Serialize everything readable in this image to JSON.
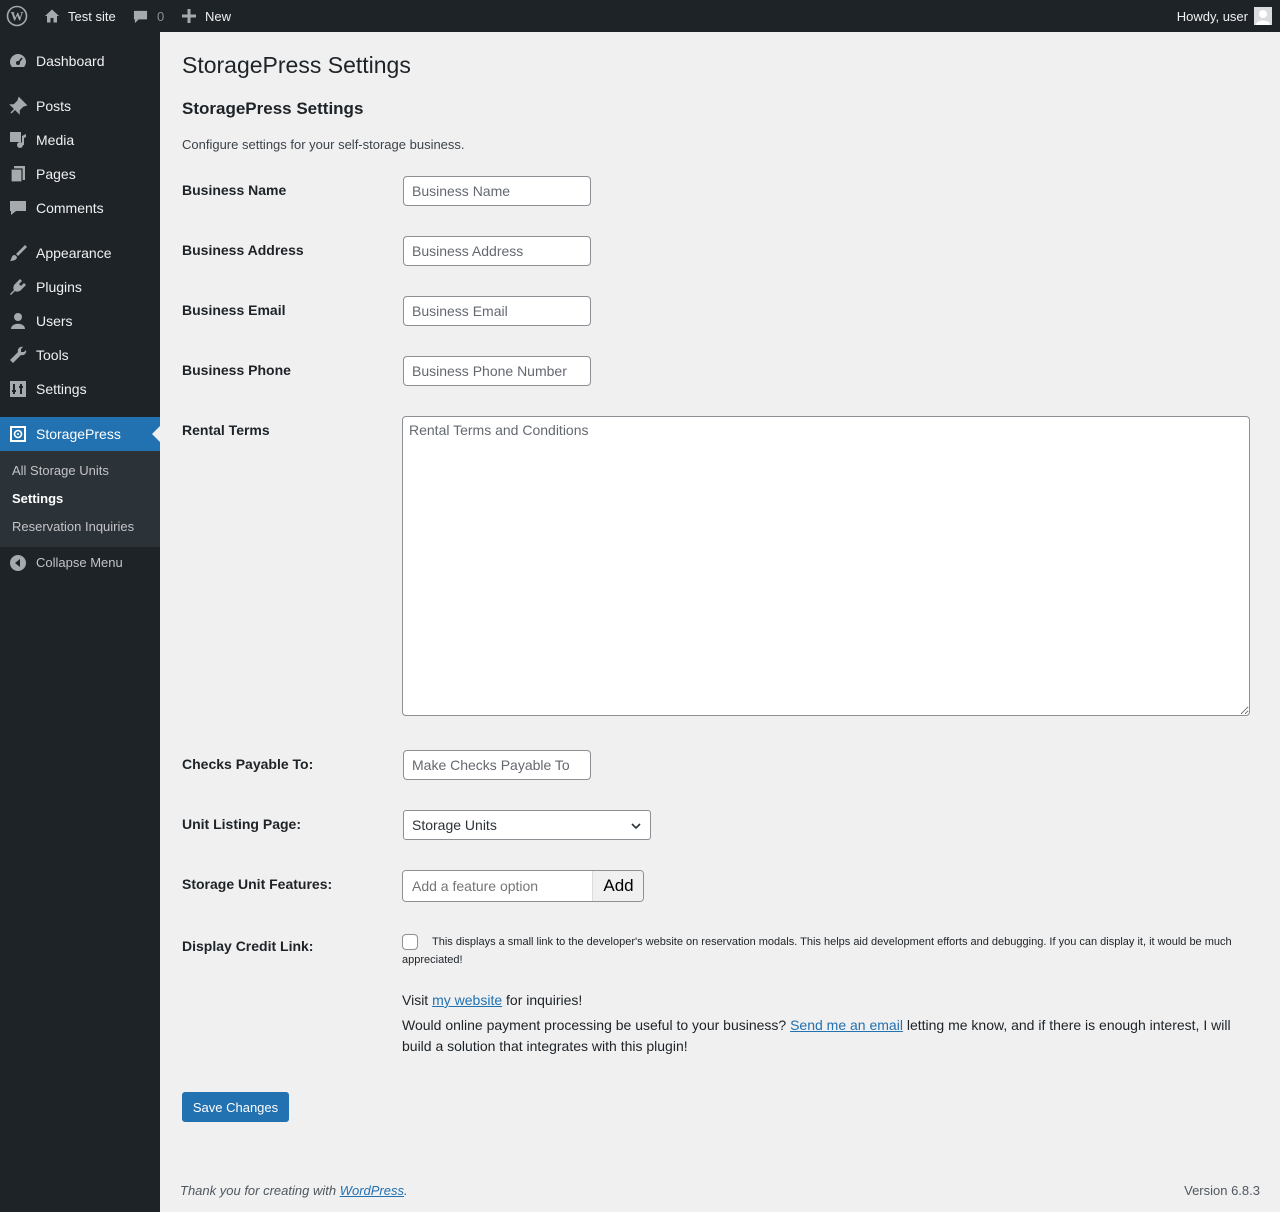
{
  "adminbar": {
    "site_name": "Test site",
    "comments_count": "0",
    "new_label": "New",
    "howdy": "Howdy, user"
  },
  "sidebar": {
    "items": [
      {
        "label": "Dashboard",
        "icon": "dashboard-icon"
      },
      {
        "label": "Posts",
        "icon": "pushpin-icon"
      },
      {
        "label": "Media",
        "icon": "media-icon"
      },
      {
        "label": "Pages",
        "icon": "pages-icon"
      },
      {
        "label": "Comments",
        "icon": "comment-icon"
      },
      {
        "label": "Appearance",
        "icon": "paintbrush-icon"
      },
      {
        "label": "Plugins",
        "icon": "plugin-icon"
      },
      {
        "label": "Users",
        "icon": "user-icon"
      },
      {
        "label": "Tools",
        "icon": "wrench-icon"
      },
      {
        "label": "Settings",
        "icon": "settings-icon"
      },
      {
        "label": "StoragePress",
        "icon": "storage-icon"
      }
    ],
    "submenu": [
      "All Storage Units",
      "Settings",
      "Reservation Inquiries"
    ],
    "collapse": "Collapse Menu"
  },
  "page": {
    "title": "StoragePress Settings",
    "section_title": "StoragePress Settings",
    "description": "Configure settings for your self-storage business."
  },
  "form": {
    "business_name": {
      "label": "Business Name",
      "placeholder": "Business Name",
      "value": ""
    },
    "business_address": {
      "label": "Business Address",
      "placeholder": "Business Address",
      "value": ""
    },
    "business_email": {
      "label": "Business Email",
      "placeholder": "Business Email",
      "value": ""
    },
    "business_phone": {
      "label": "Business Phone",
      "placeholder": "Business Phone Number",
      "value": ""
    },
    "rental_terms": {
      "label": "Rental Terms",
      "placeholder": "Rental Terms and Conditions",
      "value": ""
    },
    "checks_payable": {
      "label": "Checks Payable To:",
      "placeholder": "Make Checks Payable To",
      "value": ""
    },
    "unit_listing": {
      "label": "Unit Listing Page:",
      "selected": "Storage Units"
    },
    "features": {
      "label": "Storage Unit Features:",
      "placeholder": "Add a feature option",
      "add_label": "Add"
    },
    "credit": {
      "label": "Display Credit Link:",
      "checked": false,
      "text": "This displays a small link to the developer's website on reservation modals. This helps aid development efforts and debugging. If you can display it, it would be much appreciated!"
    },
    "visit": {
      "prefix": "Visit ",
      "link": "my website",
      "suffix": " for inquiries!"
    },
    "payment": {
      "prefix": "Would online payment processing be useful to your business? ",
      "link": "Send me an email",
      "suffix": " letting me know, and if there is enough interest, I will build a solution that integrates with this plugin!"
    },
    "save_label": "Save Changes"
  },
  "footer": {
    "thanks_prefix": "Thank you for creating with ",
    "thanks_link": "WordPress",
    "thanks_suffix": ".",
    "version": "Version 6.8.3"
  },
  "colors": {
    "accent": "#2271b1",
    "adminbar": "#1d2327",
    "background": "#f0f0f1"
  }
}
